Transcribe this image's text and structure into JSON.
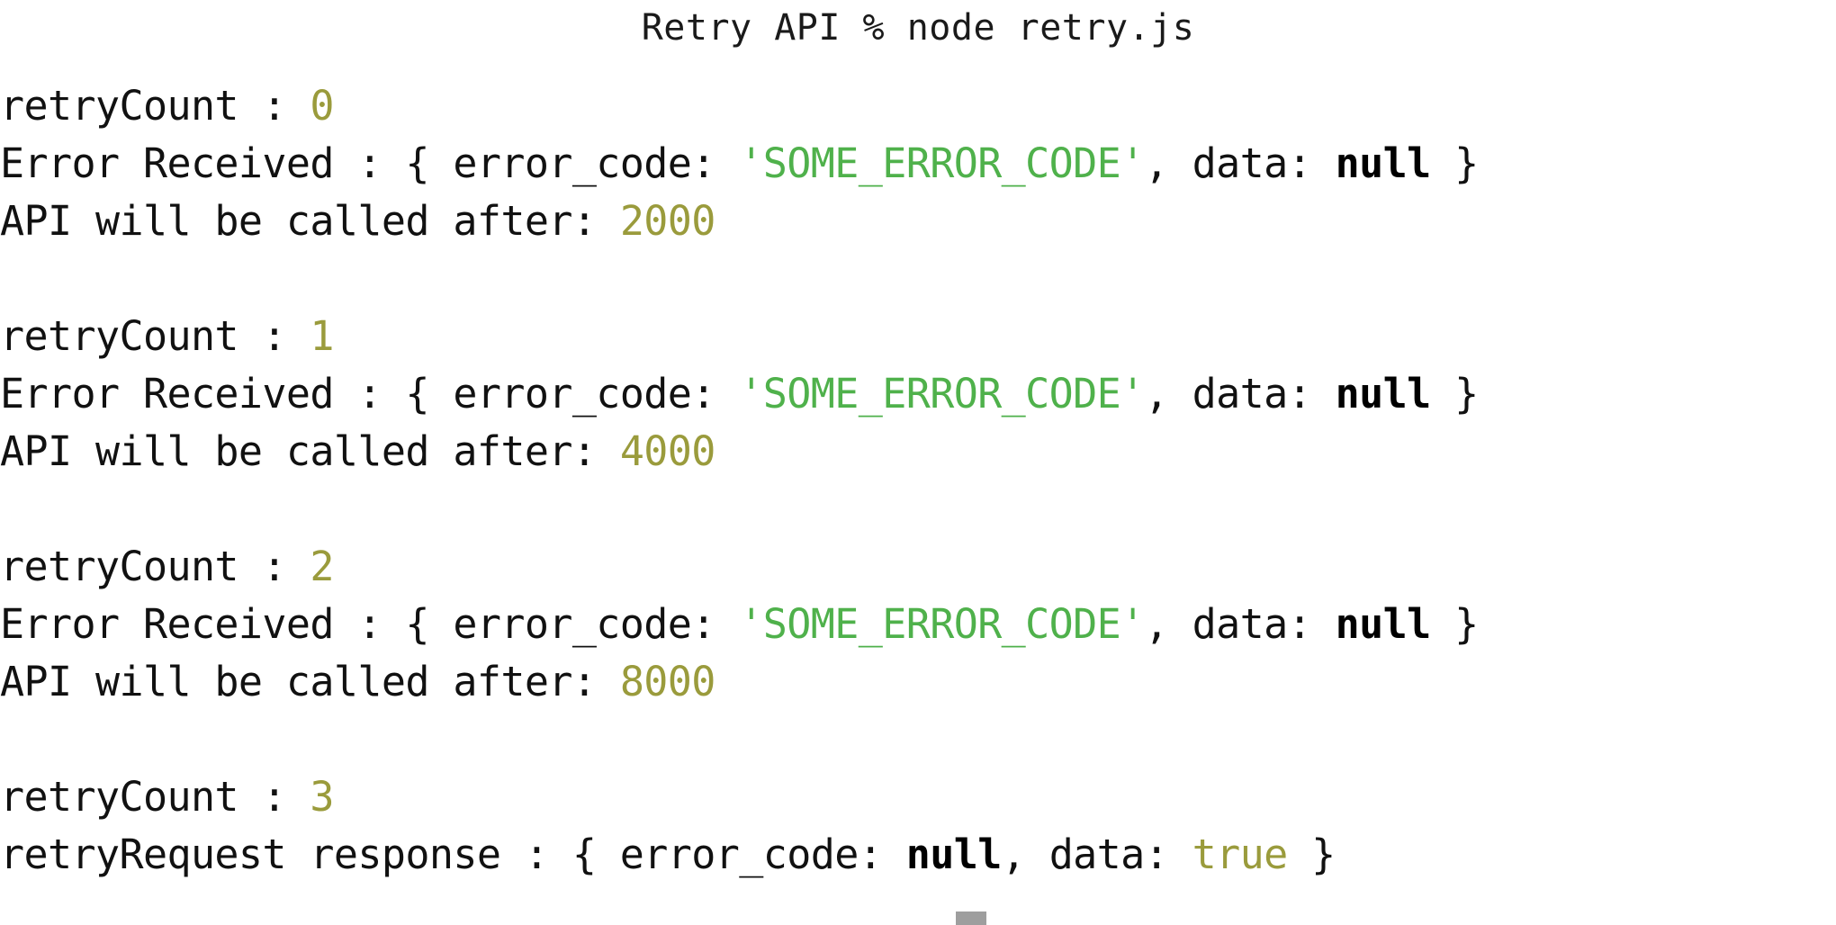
{
  "window": {
    "title": "Retry API % node retry.js",
    "shell_prompt_host": "Retry API",
    "prompt_symbol": "%",
    "command": "node retry.js"
  },
  "colors": {
    "background": "#ffffff",
    "foreground": "#111111",
    "number": "#9a9b3c",
    "string": "#4fb14b",
    "null_keyword": "#000000",
    "boolean": "#9a9b3c",
    "cursor": "#9e9e9e",
    "scroll_tick": "#a8a8a8"
  },
  "labels": {
    "retry_count": "retryCount : ",
    "error_received": "Error Received : { error_code: ",
    "error_received_mid": ", data: ",
    "error_received_end": " }",
    "api_called_after": "API will be called after: ",
    "retry_response": "retryRequest response : { error_code: ",
    "retry_response_mid": ", data: ",
    "retry_response_end": " }"
  },
  "tokens": {
    "error_code_value": "'SOME_ERROR_CODE'",
    "null_value": "null",
    "true_value": "true"
  },
  "output": {
    "blocks": [
      {
        "retry_count": "0",
        "error_code": "'SOME_ERROR_CODE'",
        "data": "null",
        "delay": "2000"
      },
      {
        "retry_count": "1",
        "error_code": "'SOME_ERROR_CODE'",
        "data": "null",
        "delay": "4000"
      },
      {
        "retry_count": "2",
        "error_code": "'SOME_ERROR_CODE'",
        "data": "null",
        "delay": "8000"
      }
    ],
    "final_block": {
      "retry_count": "3",
      "error_code": "null",
      "data": "true"
    }
  },
  "cursor": {
    "visible": true,
    "column_hint": "under retryRequest response line"
  }
}
